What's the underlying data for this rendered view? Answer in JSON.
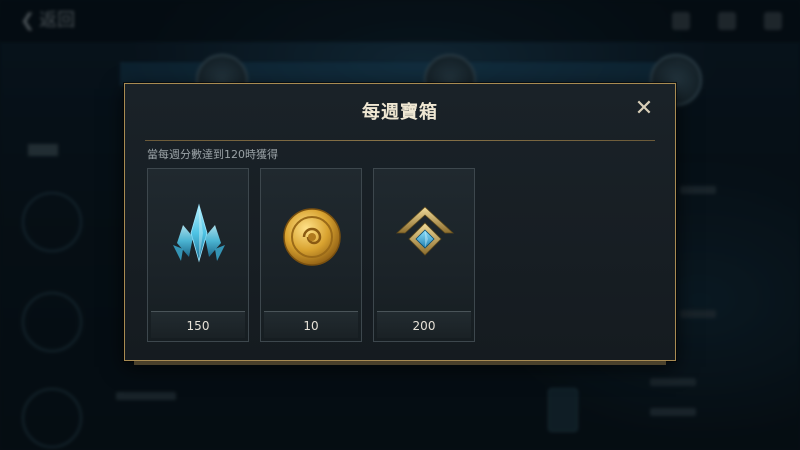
{
  "background": {
    "back_label": "返回",
    "top_icons": [
      "inbox-icon",
      "mail-icon",
      "friends-icon"
    ]
  },
  "dialog": {
    "title": "每週寶箱",
    "close_symbol": "✕",
    "subtitle": "當每週分數達到120時獲得",
    "rewards": [
      {
        "icon": "blue-crystal-icon",
        "amount": "150",
        "accent": "#5cc8e6"
      },
      {
        "icon": "gold-coin-icon",
        "amount": "10",
        "accent": "#d4a32c"
      },
      {
        "icon": "rank-emblem-icon",
        "amount": "200",
        "accent": "#c7a657"
      }
    ]
  }
}
